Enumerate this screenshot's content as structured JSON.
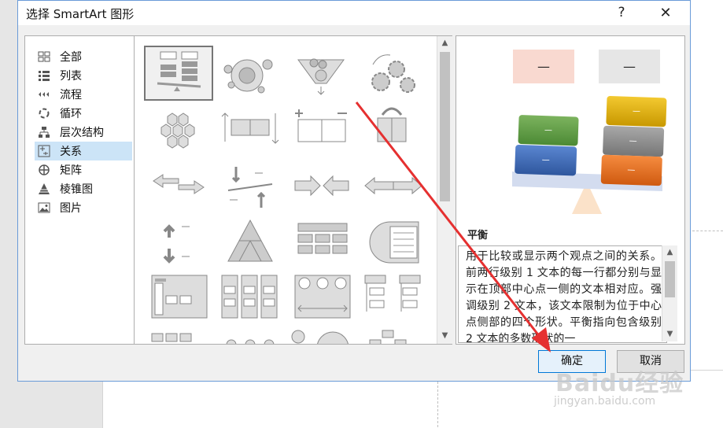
{
  "dialog": {
    "title": "选择 SmartArt 图形",
    "help": "?",
    "close": "✕"
  },
  "categories": [
    {
      "label": "全部",
      "icon": "all-icon"
    },
    {
      "label": "列表",
      "icon": "list-icon"
    },
    {
      "label": "流程",
      "icon": "process-icon"
    },
    {
      "label": "循环",
      "icon": "cycle-icon"
    },
    {
      "label": "层次结构",
      "icon": "hierarchy-icon"
    },
    {
      "label": "关系",
      "icon": "relationship-icon"
    },
    {
      "label": "矩阵",
      "icon": "matrix-icon"
    },
    {
      "label": "棱锥图",
      "icon": "pyramid-icon"
    },
    {
      "label": "图片",
      "icon": "picture-icon"
    }
  ],
  "selected_category": "关系",
  "preview": {
    "name": "平衡",
    "description": "用于比较或显示两个观点之间的关系。前两行级别 1 文本的每一行都分别与显示在顶部中心点一侧的文本相对应。强调级别 2 文本，该文本限制为位于中心点侧部的四个形状。平衡指向包含级别 2 文本的多数形状的一",
    "placeholder": "—",
    "colors": {
      "left_header": "#f9d9d0",
      "right_header": "#e6e6e6",
      "green": "#5b9a43",
      "blue": "#3a66b5",
      "yellow": "#e0b100",
      "gray": "#8c8c8c",
      "orange": "#e86f1f",
      "beam": "#d3dcef",
      "fulcrum": "#fbe2c9"
    }
  },
  "buttons": {
    "ok": "确定",
    "cancel": "取消"
  },
  "watermark": {
    "logo": "Baidu经验",
    "url": "jingyan.baidu.com"
  },
  "annotation_color": "#e53030"
}
